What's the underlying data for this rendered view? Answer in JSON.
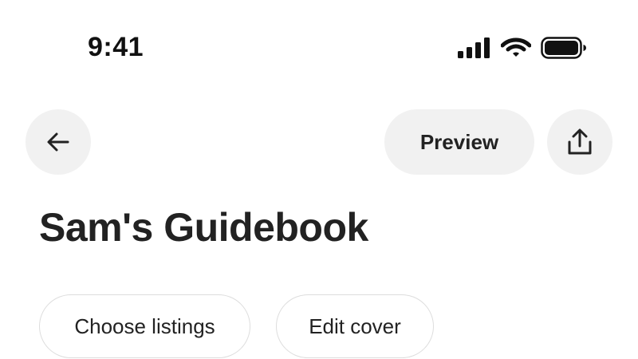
{
  "status_bar": {
    "time": "9:41",
    "icons": [
      "signal-icon",
      "wifi-icon",
      "battery-icon"
    ]
  },
  "header": {
    "back_icon": "arrow-left-icon",
    "preview_label": "Preview",
    "share_icon": "share-icon"
  },
  "page": {
    "title": "Sam's Guidebook"
  },
  "actions": {
    "choose_listings_label": "Choose listings",
    "edit_cover_label": "Edit cover"
  },
  "colors": {
    "button_bg": "#f1f1f1",
    "text": "#222222",
    "chip_border": "#dddddd"
  }
}
